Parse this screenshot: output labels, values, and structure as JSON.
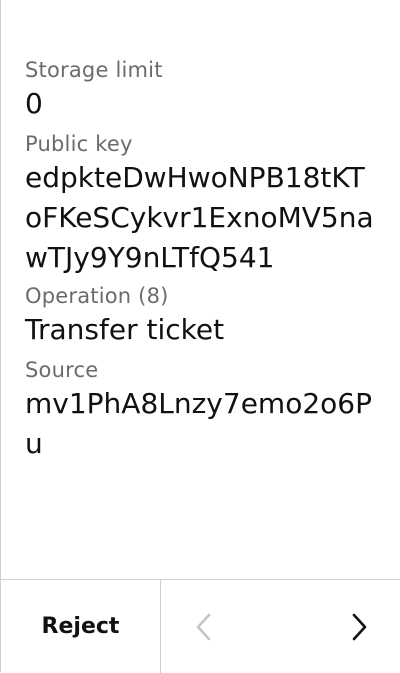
{
  "fields": [
    {
      "label": "Storage limit",
      "value": "0"
    },
    {
      "label": "Public key",
      "value": "edpkteDwHwoNPB18tKToFKeSCykvr1ExnoMV5nawTJy9Y9nLTfQ541"
    },
    {
      "label": "Operation (8)",
      "value": "Transfer ticket"
    },
    {
      "label": "Source",
      "value": "mv1PhA8Lnzy7emo2o6Pu"
    }
  ],
  "footer": {
    "reject_label": "Reject",
    "prev_icon": "chevron-left-icon",
    "next_icon": "chevron-right-icon",
    "prev_disabled": true
  },
  "colors": {
    "label": "#6b6b6b",
    "value": "#111111",
    "divider": "#cfcfcf",
    "disabled_icon": "#c4c4c4"
  }
}
